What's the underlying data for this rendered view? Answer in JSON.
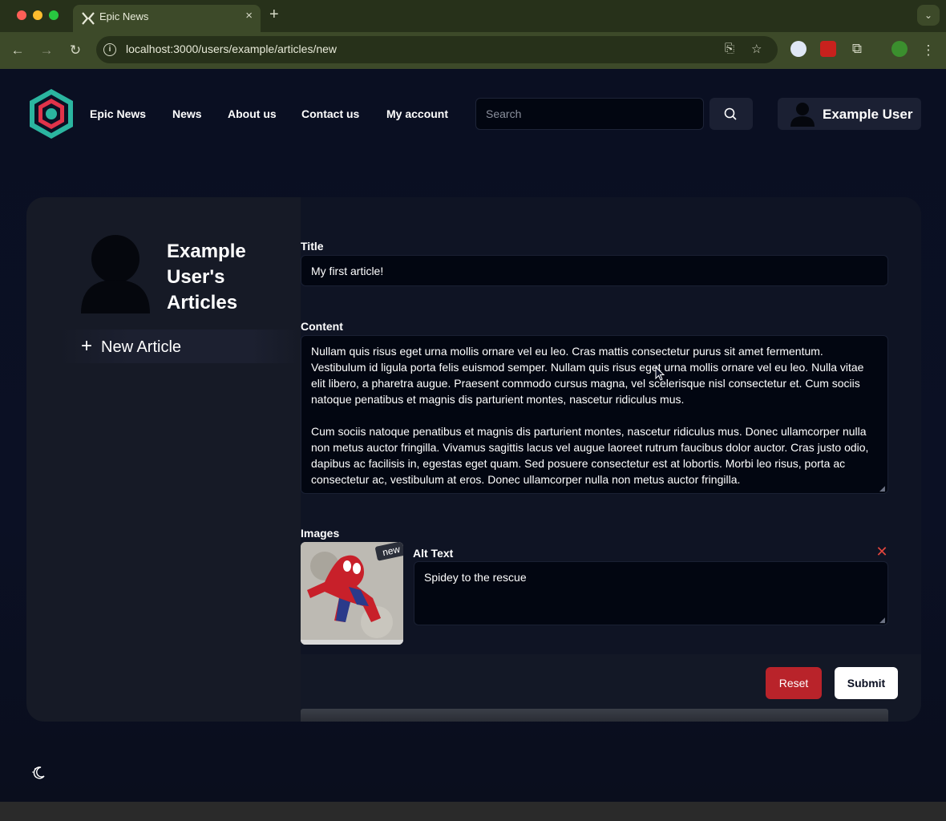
{
  "browser": {
    "tab_title": "Epic News",
    "tab_close": "×",
    "new_tab": "+",
    "url": "localhost:3000/users/example/articles/new"
  },
  "header": {
    "site_title": "Epic News",
    "nav": [
      "News",
      "About us",
      "Contact us",
      "My account"
    ],
    "search_placeholder": "Search",
    "user_name": "Example User"
  },
  "sidebar": {
    "heading": "Example User's Articles",
    "new_article_label": "New Article"
  },
  "form": {
    "title_label": "Title",
    "title_value": "My first article!",
    "content_label": "Content",
    "content_value": "Nullam quis risus eget urna mollis ornare vel eu leo. Cras mattis consectetur purus sit amet fermentum. Vestibulum id ligula porta felis euismod semper. Nullam quis risus eget urna mollis ornare vel eu leo. Nulla vitae elit libero, a pharetra augue. Praesent commodo cursus magna, vel scelerisque nisl consectetur et. Cum sociis natoque penatibus et magnis dis parturient montes, nascetur ridiculus mus.\n\nCum sociis natoque penatibus et magnis dis parturient montes, nascetur ridiculus mus. Donec ullamcorper nulla non metus auctor fringilla. Vivamus sagittis lacus vel augue laoreet rutrum faucibus dolor auctor. Cras justo odio, dapibus ac facilisis in, egestas eget quam. Sed posuere consectetur est at lobortis. Morbi leo risus, porta ac consectetur ac, vestibulum at eros. Donec ullamcorper nulla non metus auctor fringilla.",
    "images_label": "Images",
    "image_badge": "new",
    "alt_label": "Alt Text",
    "alt_value": "Spidey to the rescue",
    "reset_label": "Reset",
    "submit_label": "Submit"
  },
  "colors": {
    "accent_teal": "#2bb5a0",
    "accent_red": "#e0334a",
    "reset_red": "#b9232a",
    "page_bg": "#0a0f22"
  },
  "icons": {
    "logo": "hexagon-logo-icon",
    "search": "search-icon",
    "theme": "moon-icon",
    "remove": "close-icon"
  }
}
